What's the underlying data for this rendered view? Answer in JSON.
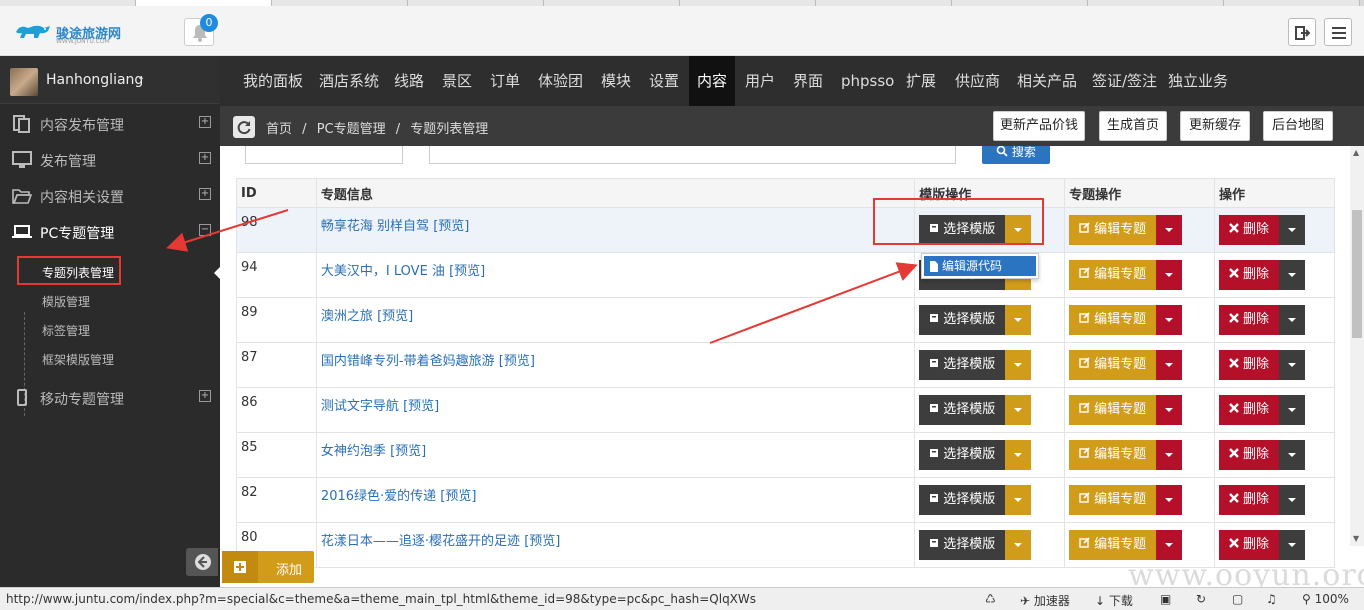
{
  "brand": {
    "name": "骏途旅游网",
    "domain": "WWW.JUNTU.COM"
  },
  "notifications": {
    "count": "0"
  },
  "user": {
    "name": "Hanhongliang"
  },
  "sidebar": {
    "items": [
      {
        "label": "内容发布管理",
        "toggle": "⊞"
      },
      {
        "label": "发布管理",
        "toggle": "⊞"
      },
      {
        "label": "内容相关设置",
        "toggle": "⊞"
      },
      {
        "label": "PC专题管理",
        "toggle": "⊟"
      },
      {
        "label": "移动专题管理",
        "toggle": "⊞"
      }
    ],
    "subitems": [
      "专题列表管理",
      "模版管理",
      "标签管理",
      "框架模版管理"
    ]
  },
  "topnav": [
    "我的面板",
    "酒店系统",
    "线路",
    "景区",
    "订单",
    "体验团",
    "模块",
    "设置",
    "内容",
    "用户",
    "界面",
    "phpsso",
    "扩展",
    "供应商",
    "相关产品",
    "签证/签注",
    "独立业务"
  ],
  "breadcrumb": [
    "首页",
    "/",
    "PC专题管理",
    "/",
    "专题列表管理"
  ],
  "actions": [
    "更新产品价钱",
    "生成首页",
    "更新缓存",
    "后台地图"
  ],
  "search": {
    "button": "搜索"
  },
  "table": {
    "headers": [
      "ID",
      "专题信息",
      "模版操作",
      "专题操作",
      "操作"
    ],
    "preview_label": "[预览]",
    "template_btn": "选择模版",
    "edit_btn": "编辑专题",
    "delete_btn": "删除",
    "rows": [
      {
        "id": "98",
        "title": "畅享花海 别样自驾"
      },
      {
        "id": "94",
        "title": "大美汉中，I LOVE 油"
      },
      {
        "id": "89",
        "title": "澳洲之旅"
      },
      {
        "id": "87",
        "title": "国内错峰专列-带着爸妈趣旅游"
      },
      {
        "id": "86",
        "title": "测试文字导航"
      },
      {
        "id": "85",
        "title": "女神约泡季"
      },
      {
        "id": "82",
        "title": "2016绿色·爱的传递"
      },
      {
        "id": "80",
        "title": "花漾日本——追逐·樱花盛开的足迹"
      }
    ]
  },
  "dropdown": {
    "item": "编辑源代码"
  },
  "add_button": "添加",
  "statusbar": {
    "url": "http://www.juntu.com/index.php?m=special&c=theme&a=theme_main_tpl_html&theme_id=98&type=pc&pc_hash=QlqXWs",
    "accelerator": "加速器",
    "download": "下载",
    "zoom": "100%"
  },
  "watermark": "www.ooyun.org",
  "colors": {
    "accent_blue": "#2a74c2",
    "gold": "#d29c1b",
    "crimson": "#b5102a",
    "dark": "#3d3d3d",
    "annotation_red": "#e53935"
  }
}
